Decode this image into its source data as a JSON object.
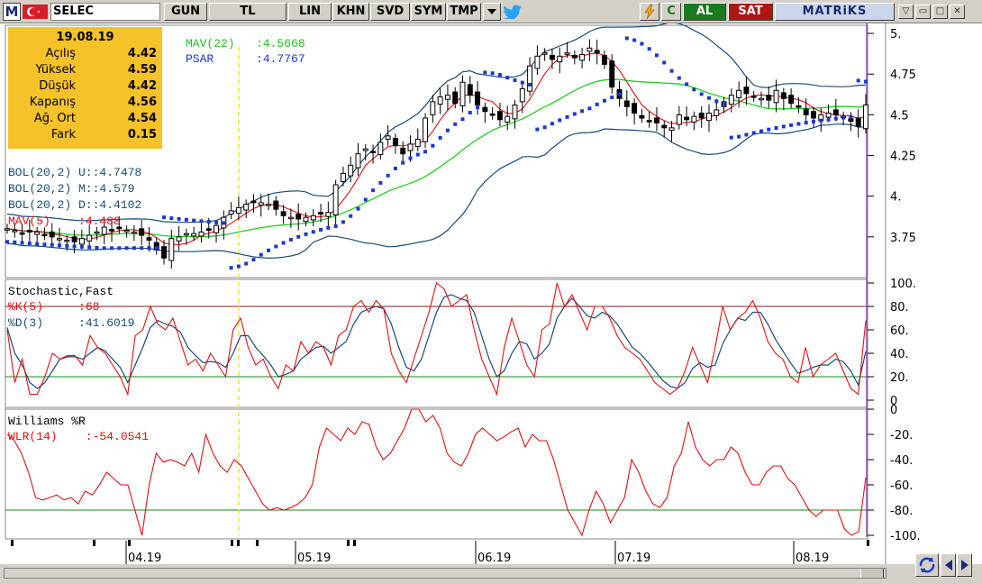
{
  "toolbar": {
    "logo": "M",
    "symbol": "SELEC",
    "buttons": [
      "GUN",
      "TL",
      "LIN",
      "KHN",
      "SVD",
      "SYM",
      "TMP"
    ],
    "al": "AL",
    "sat": "SAT",
    "matriks": "MATRiKS",
    "colors": {
      "al": "#1a7a20",
      "sat": "#b01515",
      "panel": "#d4d0c8"
    }
  },
  "info": {
    "date": "19.08.19",
    "rows": [
      {
        "label": "Açılış",
        "value": "4.42"
      },
      {
        "label": "Yüksek",
        "value": "4.59"
      },
      {
        "label": "Düşük",
        "value": "4.42"
      },
      {
        "label": "Kapanış",
        "value": "4.56"
      },
      {
        "label": "Ağ. Ort",
        "value": "4.54"
      },
      {
        "label": "Fark",
        "value": "0.15"
      }
    ]
  },
  "legends": {
    "mav22": {
      "name": "MAV(22)",
      "value": ":4.5668",
      "color": "#22bb22"
    },
    "psar": {
      "name": "PSAR",
      "value": ":4.7767",
      "color": "#1a3acc"
    },
    "bol_u": {
      "name": "BOL(20,2) U:",
      "value": ":4.7478",
      "color": "#1a4a7a"
    },
    "bol_m": {
      "name": "BOL(20,2) M:",
      "value": ":4.579",
      "color": "#1a4a7a"
    },
    "bol_d": {
      "name": "BOL(20,2) D:",
      "value": ":4.4102",
      "color": "#1a4a7a"
    },
    "mav5": {
      "name": "MAV(5)",
      "value": ":4.488",
      "color": "#dd1111"
    },
    "stoch_title": "Stochastic,Fast",
    "k5": {
      "name": "%K(5)",
      "value": ":68",
      "color": "#dd1111"
    },
    "d3": {
      "name": "%D(3)",
      "value": ":41.6019",
      "color": "#1a4a7a"
    },
    "williams_title": "Williams %R",
    "wlr": {
      "name": "WLR(14)",
      "value": ":-54.0541",
      "color": "#dd1111"
    }
  },
  "chart_data": [
    {
      "type": "candlestick",
      "title": "SELEC",
      "x_labels": [
        "04.19",
        "05.19",
        "06.19",
        "07.19",
        "08.19"
      ],
      "y_ticks": [
        "5.",
        "4.75",
        "4.5",
        "4.25",
        "4.",
        "3.75"
      ],
      "ylim": [
        3.5,
        5.05
      ],
      "series_close": [
        3.8,
        3.79,
        3.77,
        3.78,
        3.78,
        3.76,
        3.75,
        3.74,
        3.73,
        3.72,
        3.74,
        3.76,
        3.78,
        3.81,
        3.79,
        3.8,
        3.79,
        3.78,
        3.76,
        3.73,
        3.67,
        3.62,
        3.74,
        3.75,
        3.77,
        3.77,
        3.78,
        3.79,
        3.82,
        3.87,
        3.91,
        3.93,
        3.95,
        3.96,
        3.96,
        3.95,
        3.92,
        3.88,
        3.87,
        3.86,
        3.87,
        3.88,
        3.89,
        3.9,
        4.07,
        4.14,
        4.19,
        4.26,
        4.29,
        4.27,
        4.33,
        4.37,
        4.31,
        4.26,
        4.32,
        4.35,
        4.48,
        4.58,
        4.61,
        4.62,
        4.57,
        4.7,
        4.62,
        4.56,
        4.52,
        4.5,
        4.47,
        4.49,
        4.56,
        4.66,
        4.8,
        4.86,
        4.88,
        4.84,
        4.86,
        4.88,
        4.85,
        4.87,
        4.91,
        4.88,
        4.81,
        4.67,
        4.6,
        4.55,
        4.51,
        4.48,
        4.46,
        4.45,
        4.42,
        4.42,
        4.5,
        4.47,
        4.49,
        4.48,
        4.51,
        4.53,
        4.58,
        4.62,
        4.65,
        4.63,
        4.61,
        4.6,
        4.59,
        4.65,
        4.6,
        4.57,
        4.55,
        4.5,
        4.48,
        4.5,
        4.51,
        4.5,
        4.49,
        4.46,
        4.43,
        4.56
      ],
      "bollinger": {
        "upper": 4.7478,
        "middle": 4.579,
        "lower": 4.4102
      },
      "mav22": 4.5668,
      "mav5": 4.488,
      "psar": 4.7767
    },
    {
      "type": "line",
      "title": "Stochastic,Fast",
      "ylim": [
        0,
        100
      ],
      "y_ticks": [
        "100.",
        "80.",
        "60.",
        "40.",
        "20.",
        "0"
      ],
      "ref_lines": [
        80,
        20
      ],
      "series": [
        {
          "name": "%K(5)",
          "values": [
            60,
            15,
            35,
            5,
            5,
            20,
            40,
            35,
            38,
            38,
            30,
            55,
            45,
            40,
            30,
            20,
            5,
            55,
            60,
            80,
            65,
            60,
            70,
            50,
            30,
            35,
            25,
            40,
            30,
            20,
            60,
            70,
            45,
            30,
            35,
            20,
            10,
            30,
            25,
            50,
            40,
            50,
            45,
            30,
            55,
            60,
            80,
            85,
            75,
            85,
            78,
            40,
            25,
            15,
            35,
            55,
            75,
            100,
            95,
            80,
            85,
            90,
            60,
            35,
            20,
            5,
            45,
            70,
            50,
            30,
            20,
            60,
            65,
            100,
            80,
            90,
            75,
            60,
            80,
            80,
            70,
            55,
            45,
            40,
            35,
            25,
            15,
            10,
            5,
            10,
            25,
            45,
            30,
            15,
            45,
            80,
            60,
            70,
            75,
            85,
            70,
            50,
            40,
            35,
            20,
            15,
            45,
            20,
            30,
            35,
            40,
            25,
            10,
            5,
            68
          ]
        },
        {
          "name": "%D(3)",
          "values": [
            62,
            40,
            30,
            15,
            10,
            15,
            25,
            35,
            37,
            37,
            35,
            40,
            45,
            42,
            35,
            28,
            15,
            30,
            45,
            62,
            68,
            65,
            63,
            58,
            45,
            38,
            32,
            33,
            32,
            28,
            40,
            55,
            55,
            45,
            38,
            30,
            20,
            22,
            25,
            35,
            40,
            45,
            46,
            40,
            45,
            50,
            65,
            75,
            78,
            80,
            78,
            65,
            45,
            28,
            25,
            35,
            55,
            75,
            88,
            90,
            87,
            85,
            75,
            55,
            35,
            20,
            25,
            40,
            50,
            48,
            35,
            40,
            48,
            70,
            80,
            87,
            80,
            72,
            70,
            75,
            72,
            65,
            55,
            45,
            40,
            33,
            25,
            17,
            12,
            10,
            15,
            27,
            32,
            28,
            30,
            48,
            60,
            70,
            68,
            75,
            75,
            65,
            52,
            42,
            32,
            23,
            25,
            28,
            30,
            30,
            35,
            33,
            25,
            13,
            41.6019
          ]
        }
      ]
    },
    {
      "type": "line",
      "title": "Williams %R",
      "ylim": [
        -100,
        0
      ],
      "y_ticks": [
        "0",
        "-20.",
        "-40.",
        "-60.",
        "-80.",
        "-100."
      ],
      "ref_lines": [
        -80
      ],
      "series": [
        {
          "name": "WLR(14)",
          "values": [
            -20,
            -25,
            -35,
            -50,
            -70,
            -72,
            -70,
            -68,
            -72,
            -70,
            -75,
            -65,
            -68,
            -60,
            -50,
            -55,
            -60,
            -60,
            -80,
            -100,
            -60,
            -35,
            -42,
            -40,
            -42,
            -45,
            -35,
            -50,
            -20,
            -35,
            -45,
            -50,
            -40,
            -45,
            -55,
            -65,
            -75,
            -80,
            -78,
            -80,
            -78,
            -75,
            -70,
            -60,
            -30,
            -15,
            -20,
            -25,
            -15,
            -20,
            -10,
            -12,
            -30,
            -40,
            -35,
            -25,
            -15,
            0,
            0,
            -10,
            -5,
            -15,
            -35,
            -42,
            -45,
            -35,
            -20,
            -15,
            -20,
            -25,
            -22,
            -18,
            -15,
            -30,
            -20,
            -25,
            -25,
            -40,
            -60,
            -80,
            -90,
            -100,
            -80,
            -65,
            -75,
            -90,
            -80,
            -70,
            -40,
            -50,
            -65,
            -75,
            -78,
            -70,
            -45,
            -35,
            -10,
            -30,
            -40,
            -45,
            -40,
            -40,
            -30,
            -35,
            -50,
            -60,
            -60,
            -50,
            -45,
            -45,
            -55,
            -60,
            -70,
            -80,
            -85,
            -80,
            -80,
            -80,
            -95,
            -100,
            -97,
            -54.0541
          ]
        }
      ]
    }
  ]
}
